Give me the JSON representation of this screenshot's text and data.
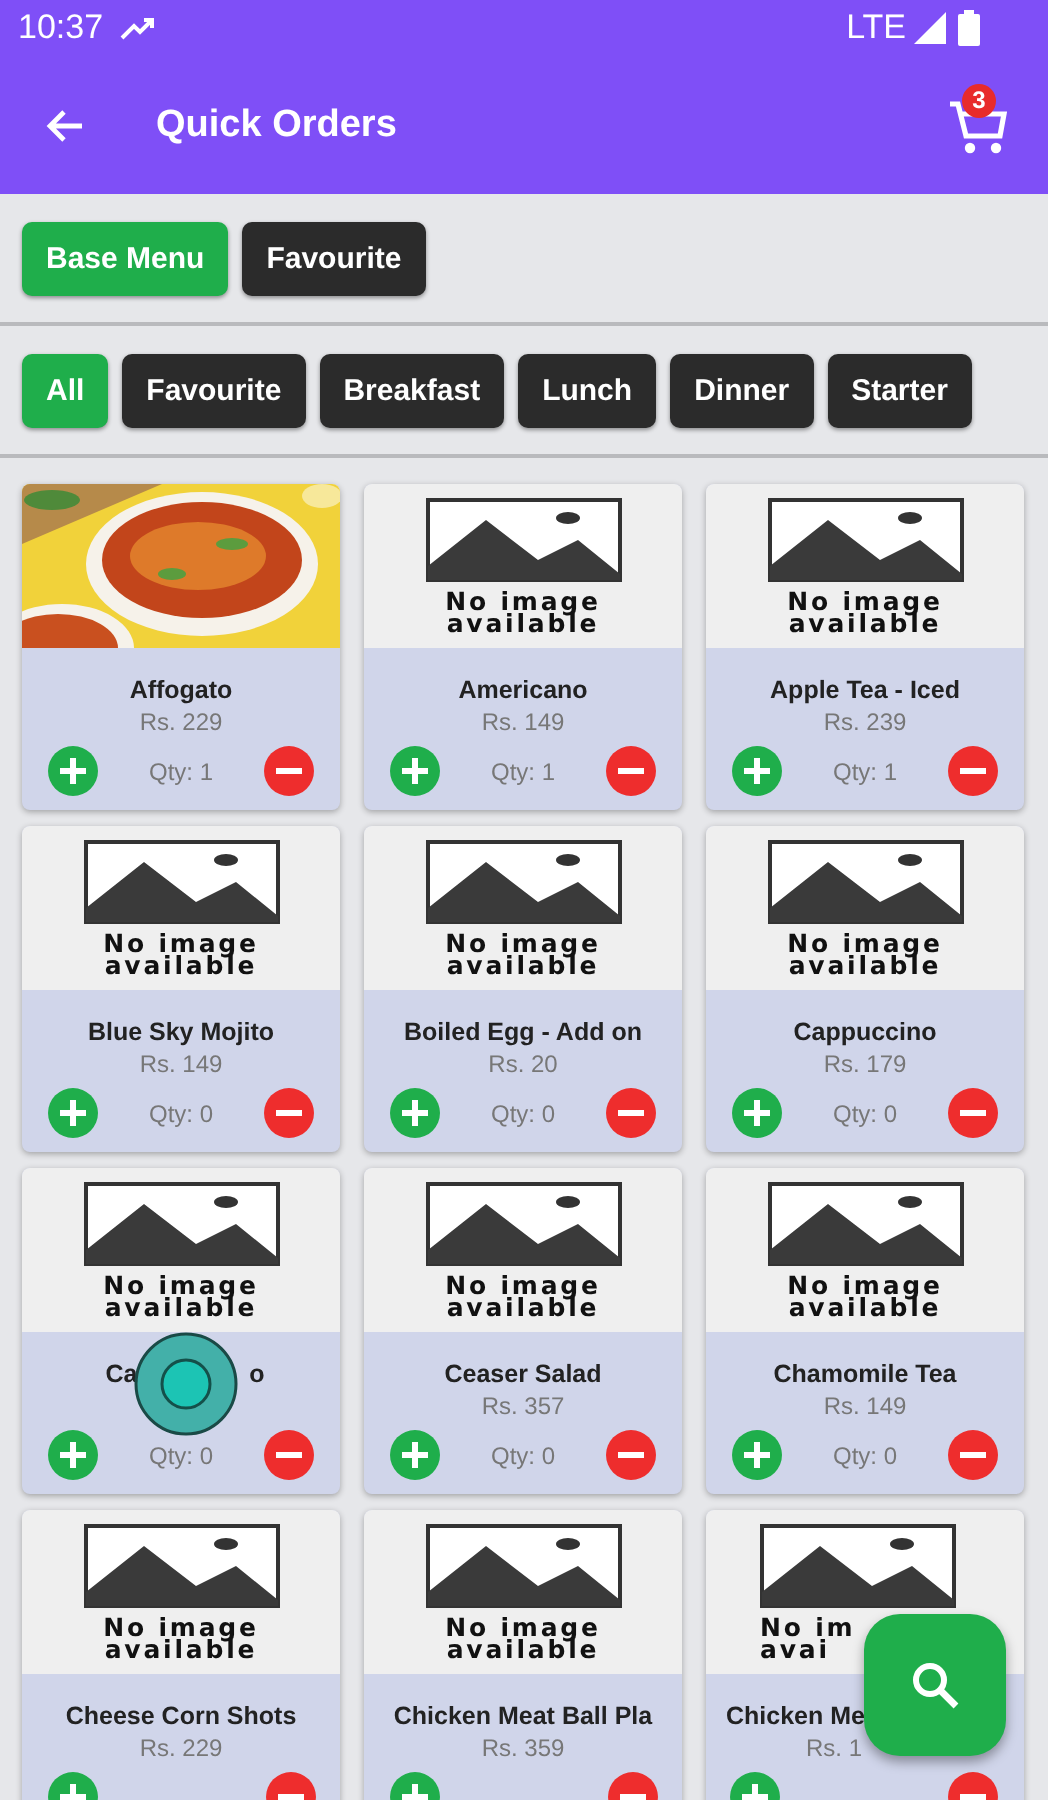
{
  "status_bar": {
    "time": "10:37",
    "network": "LTE"
  },
  "app_bar": {
    "title": "Quick Orders",
    "cart_count": "3"
  },
  "menu_tabs": [
    {
      "label": "Base Menu",
      "selected": true
    },
    {
      "label": "Favourite",
      "selected": false
    }
  ],
  "categories": [
    {
      "label": "All",
      "selected": true
    },
    {
      "label": "Favourite",
      "selected": false
    },
    {
      "label": "Breakfast",
      "selected": false
    },
    {
      "label": "Lunch",
      "selected": false
    },
    {
      "label": "Dinner",
      "selected": false
    },
    {
      "label": "Starter",
      "selected": false
    }
  ],
  "items": [
    {
      "name": "Affogato",
      "price": "Rs. 229",
      "qty": "Qty: 1"
    },
    {
      "image": {
        "kind": "placeholder",
        "lines": [
          "No image",
          "available"
        ]
      },
      "name": "Americano",
      "price": "Rs. 149",
      "qty": "Qty: 1"
    },
    {
      "image": {
        "kind": "placeholder",
        "lines": [
          "No image",
          "available"
        ]
      },
      "name": "Apple Tea - Iced",
      "price": "Rs. 239",
      "qty": "Qty: 1"
    },
    {
      "image": {
        "kind": "placeholder",
        "lines": [
          "No image",
          "available"
        ]
      },
      "name": "Blue Sky Mojito",
      "price": "Rs. 149",
      "qty": "Qty: 0"
    },
    {
      "image": {
        "kind": "placeholder",
        "lines": [
          "No image",
          "available"
        ]
      },
      "name": "Boiled Egg - Add on",
      "price": "Rs. 20",
      "qty": "Qty: 0"
    },
    {
      "image": {
        "kind": "placeholder",
        "lines": [
          "No image",
          "available"
        ]
      },
      "name": "Cappuccino",
      "price": "Rs. 179",
      "qty": "Qty: 0"
    },
    {
      "image": {
        "kind": "placeholder",
        "lines": [
          "No image",
          "available"
        ]
      },
      "name_parts": [
        "Ca",
        "o"
      ],
      "qty": "Qty: 0",
      "touch_indicator": true
    },
    {
      "image": {
        "kind": "placeholder",
        "lines": [
          "No image",
          "available"
        ]
      },
      "name": "Ceaser Salad",
      "price": "Rs. 357",
      "qty": "Qty: 0"
    },
    {
      "image": {
        "kind": "placeholder",
        "lines": [
          "No image",
          "available"
        ]
      },
      "name": "Chamomile Tea",
      "price": "Rs. 149",
      "qty": "Qty: 0"
    },
    {
      "image": {
        "kind": "placeholder",
        "lines": [
          "No image",
          "available"
        ]
      },
      "name": "Cheese Corn Shots",
      "price": "Rs. 229"
    },
    {
      "image": {
        "kind": "placeholder",
        "lines": [
          "No image",
          "available"
        ]
      },
      "name": "Chicken Meat Ball Pla",
      "price": "Rs. 359"
    },
    {
      "image": {
        "kind": "placeholder",
        "lines": [
          "No im",
          "avai"
        ]
      },
      "name": "Chicken Me",
      "price": "Rs. 1",
      "covered": true
    }
  ]
}
